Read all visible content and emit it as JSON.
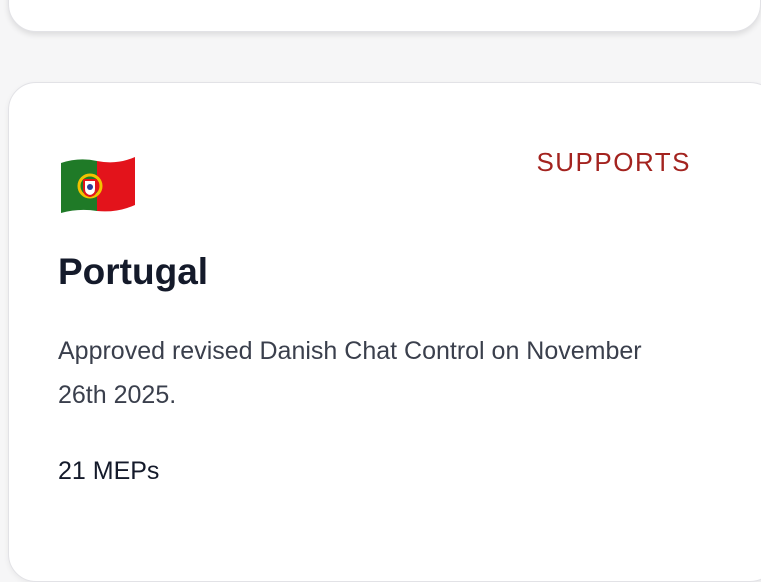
{
  "card": {
    "country": "Portugal",
    "status": "SUPPORTS",
    "description": "Approved revised Danish Chat Control on November 26th 2025.",
    "meps": "21 MEPs",
    "flag_icon": "portugal-flag-icon"
  },
  "colors": {
    "status": "#a3231f",
    "title": "#141a2a",
    "body_text": "#3a3f4c",
    "flag_green": "#1f7a27",
    "flag_red": "#e3131b",
    "flag_yellow": "#f2c200"
  }
}
